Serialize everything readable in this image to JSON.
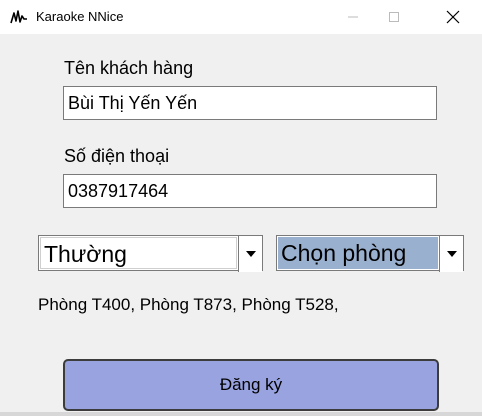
{
  "window": {
    "title": "Karaoke NNice",
    "icon": "waveform-app-icon",
    "controls": [
      "minimize-icon",
      "maximize-icon",
      "close-icon"
    ]
  },
  "form": {
    "customer_name_label": "Tên khách hàng",
    "customer_name_value": "Bùi Thị Yến Yến",
    "phone_label": "Số điện thoại",
    "phone_value": "0387917464",
    "type_combo": {
      "selected": "Thường",
      "icon": "chevron-down-icon"
    },
    "room_combo": {
      "selected": "Chọn phòng",
      "icon": "chevron-down-icon",
      "highlight_color": "#99b0cf"
    },
    "rooms_text": "Phòng T400, Phòng T873, Phòng T528,",
    "register_label": "Đăng ký",
    "register_color": "#98a3e0"
  }
}
